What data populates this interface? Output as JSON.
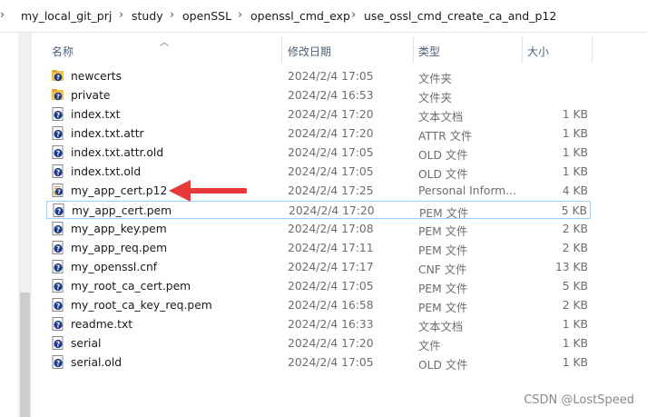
{
  "breadcrumb": {
    "items": [
      "my_local_git_prj",
      "study",
      "openSSL",
      "openssl_cmd_exp",
      "use_ossl_cmd_create_ca_and_p12"
    ]
  },
  "columns": {
    "name": "名称",
    "date": "修改日期",
    "type": "类型",
    "size": "大小"
  },
  "files": [
    {
      "name": "newcerts",
      "date": "2024/2/4 17:05",
      "type": "文件夹",
      "size": "",
      "icon": "folder-icon"
    },
    {
      "name": "private",
      "date": "2024/2/4 16:53",
      "type": "文件夹",
      "size": "",
      "icon": "folder-icon"
    },
    {
      "name": "index.txt",
      "date": "2024/2/4 17:20",
      "type": "文本文档",
      "size": "1 KB",
      "icon": "file-icon"
    },
    {
      "name": "index.txt.attr",
      "date": "2024/2/4 17:20",
      "type": "ATTR 文件",
      "size": "1 KB",
      "icon": "file-icon"
    },
    {
      "name": "index.txt.attr.old",
      "date": "2024/2/4 17:05",
      "type": "OLD 文件",
      "size": "1 KB",
      "icon": "file-icon"
    },
    {
      "name": "index.txt.old",
      "date": "2024/2/4 17:05",
      "type": "OLD 文件",
      "size": "1 KB",
      "icon": "file-icon"
    },
    {
      "name": "my_app_cert.p12",
      "date": "2024/2/4 17:25",
      "type": "Personal Inform...",
      "size": "4 KB",
      "icon": "certificate-file-icon"
    },
    {
      "name": "my_app_cert.pem",
      "date": "2024/2/4 17:20",
      "type": "PEM 文件",
      "size": "5 KB",
      "icon": "file-icon"
    },
    {
      "name": "my_app_key.pem",
      "date": "2024/2/4 17:08",
      "type": "PEM 文件",
      "size": "2 KB",
      "icon": "file-icon"
    },
    {
      "name": "my_app_req.pem",
      "date": "2024/2/4 17:11",
      "type": "PEM 文件",
      "size": "2 KB",
      "icon": "file-icon"
    },
    {
      "name": "my_openssl.cnf",
      "date": "2024/2/4 17:17",
      "type": "CNF 文件",
      "size": "13 KB",
      "icon": "file-icon"
    },
    {
      "name": "my_root_ca_cert.pem",
      "date": "2024/2/4 17:05",
      "type": "PEM 文件",
      "size": "5 KB",
      "icon": "file-icon"
    },
    {
      "name": "my_root_ca_key_req.pem",
      "date": "2024/2/4 16:58",
      "type": "PEM 文件",
      "size": "2 KB",
      "icon": "file-icon"
    },
    {
      "name": "readme.txt",
      "date": "2024/2/4 16:33",
      "type": "文本文档",
      "size": "1 KB",
      "icon": "file-icon"
    },
    {
      "name": "serial",
      "date": "2024/2/4 17:20",
      "type": "文件",
      "size": "1 KB",
      "icon": "file-icon"
    },
    {
      "name": "serial.old",
      "date": "2024/2/4 17:05",
      "type": "OLD 文件",
      "size": "1 KB",
      "icon": "file-icon"
    }
  ],
  "selected_index": 7,
  "watermark": "CSDN @LostSpeed",
  "colors": {
    "selection_border": "#99d1ff",
    "arrow": "#e8393a",
    "header_text": "#4c607a",
    "icon_badge": "#1e3a8a",
    "folder": "#f0c24b"
  }
}
